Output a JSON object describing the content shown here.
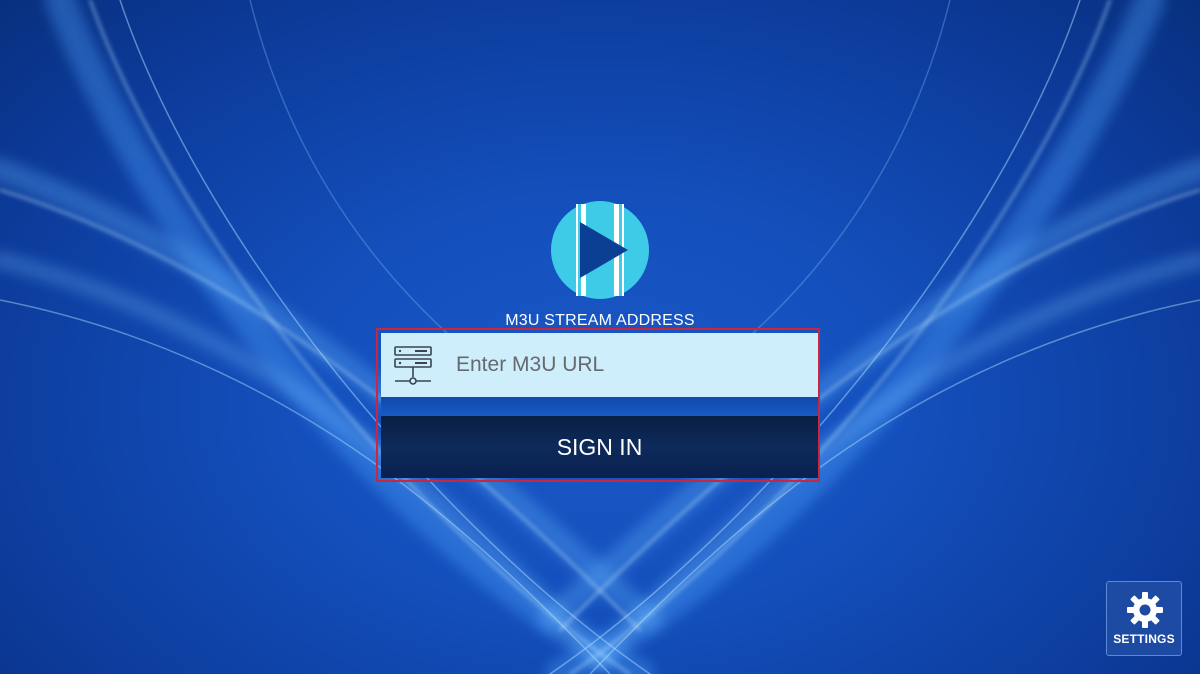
{
  "login": {
    "field_label": "M3U STREAM ADDRESS",
    "url_placeholder": "Enter M3U URL",
    "url_value": "",
    "sign_in_label": "SIGN IN"
  },
  "settings": {
    "label": "SETTINGS",
    "icon": "gear-icon"
  },
  "logo": {
    "icon": "play-logo-icon"
  },
  "colors": {
    "background": "#1450bd",
    "logo_circle": "#3ecbe8",
    "logo_play": "#0a3f93",
    "input_background": "#cdeefa",
    "button_background": "#0b2350",
    "highlight_frame": "#c8283f"
  }
}
